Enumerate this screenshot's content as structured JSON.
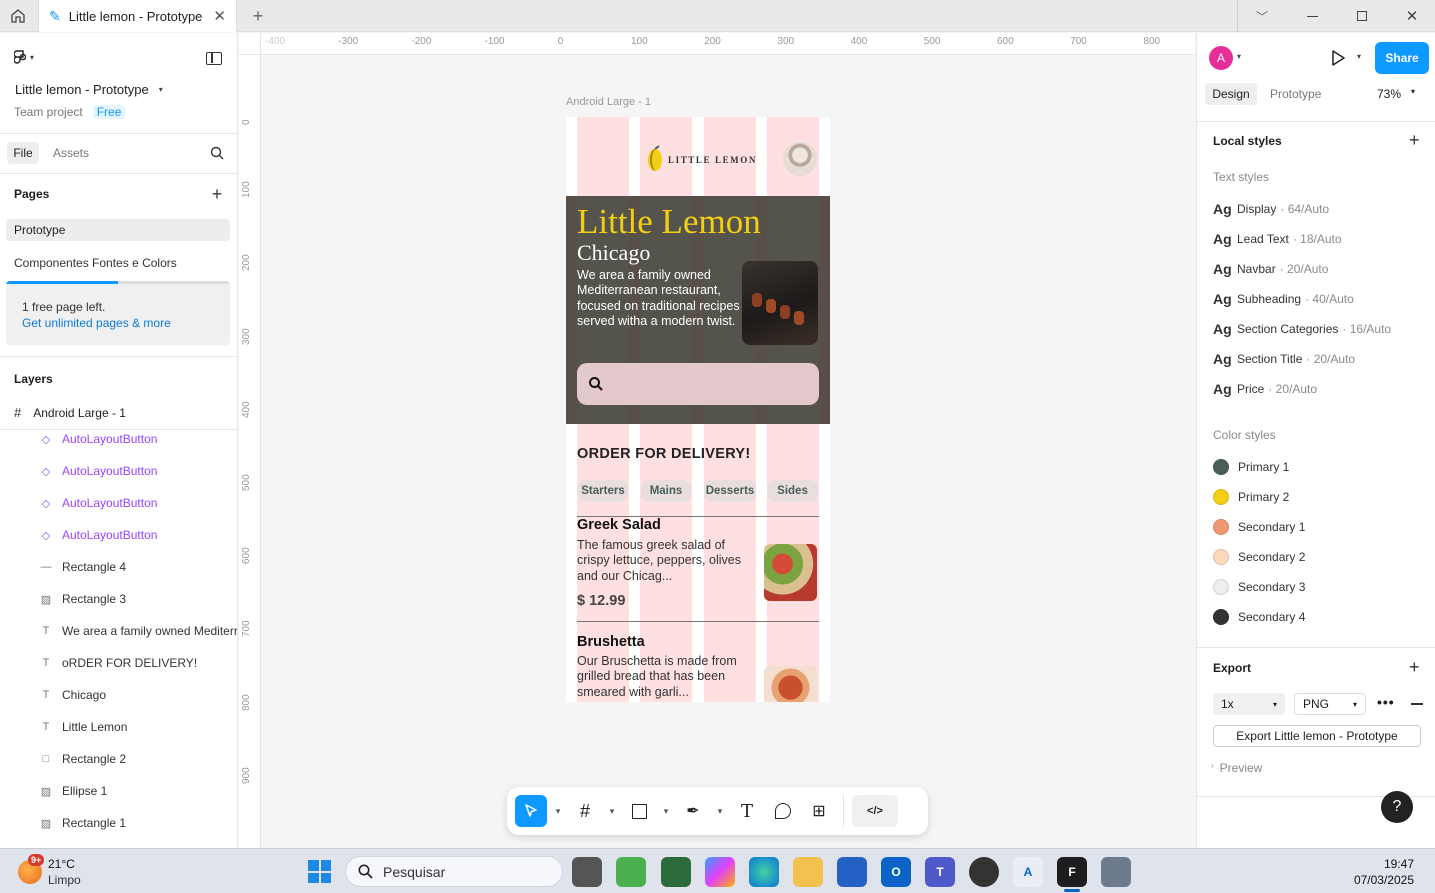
{
  "tab": {
    "title": "Little lemon - Prototype"
  },
  "file": {
    "name": "Little lemon - Prototype",
    "team": "Team project",
    "plan": "Free"
  },
  "left_tabs": {
    "file": "File",
    "assets": "Assets"
  },
  "pages": {
    "heading": "Pages",
    "items": [
      "Prototype",
      "Componentes Fontes e Colors"
    ]
  },
  "notice": {
    "text": "1 free page left.",
    "link": "Get unlimited pages & more",
    "progress": 0.5
  },
  "layers": {
    "heading": "Layers",
    "root": "Android Large - 1",
    "items": [
      {
        "name": "AutoLayoutButton",
        "icon": "component-icon"
      },
      {
        "name": "AutoLayoutButton",
        "icon": "component-icon"
      },
      {
        "name": "AutoLayoutButton",
        "icon": "component-icon"
      },
      {
        "name": "AutoLayoutButton",
        "icon": "component-icon"
      },
      {
        "name": "Rectangle 4",
        "icon": "line-icon"
      },
      {
        "name": "Rectangle 3",
        "icon": "image-icon"
      },
      {
        "name": "We area a family owned Mediterra",
        "icon": "text-icon"
      },
      {
        "name": "oRDER FOR DELIVERY!",
        "icon": "text-icon"
      },
      {
        "name": "Chicago",
        "icon": "text-icon"
      },
      {
        "name": "Little Lemon",
        "icon": "text-icon"
      },
      {
        "name": "Rectangle 2",
        "icon": "rectangle-icon"
      },
      {
        "name": "Ellipse 1",
        "icon": "image-icon"
      },
      {
        "name": "Rectangle 1",
        "icon": "image-icon"
      }
    ]
  },
  "ruler": {
    "h": [
      "-400",
      "-300",
      "-200",
      "-100",
      "0",
      "100",
      "200",
      "300",
      "400",
      "500",
      "600",
      "700",
      "800"
    ],
    "v": [
      "0",
      "100",
      "200",
      "300",
      "400",
      "500",
      "600",
      "700",
      "800",
      "900"
    ]
  },
  "frame": {
    "label": "Android Large - 1",
    "logo": "LITTLE LEMON",
    "hero_title": "Little Lemon",
    "hero_city": "Chicago",
    "hero_text": "We area a family owned Mediterranean restaurant, focused on traditional recipes served witha a modern twist.",
    "order_heading": "ORDER FOR DELIVERY!",
    "categories": [
      "Starters",
      "Mains",
      "Desserts",
      "Sides"
    ],
    "dishes": [
      {
        "name": "Greek Salad",
        "desc": "The famous greek salad of crispy lettuce, peppers, olives and our Chicag...",
        "price": "$ 12.99"
      },
      {
        "name": "Brushetta",
        "desc": "Our Bruschetta is made from grilled bread that has been smeared with garli...",
        "price": ""
      }
    ]
  },
  "right": {
    "avatar": "A",
    "share": "Share",
    "tabs": {
      "design": "Design",
      "prototype": "Prototype"
    },
    "zoom": "73%",
    "local_styles": "Local styles",
    "text_styles_heading": "Text styles",
    "text_styles": [
      {
        "name": "Display",
        "meta": "· 64/Auto"
      },
      {
        "name": "Lead Text",
        "meta": "· 18/Auto"
      },
      {
        "name": "Navbar",
        "meta": "· 20/Auto"
      },
      {
        "name": "Subheading",
        "meta": "· 40/Auto"
      },
      {
        "name": "Section Categories",
        "meta": "· 16/Auto"
      },
      {
        "name": "Section Title",
        "meta": "· 20/Auto"
      },
      {
        "name": "Price",
        "meta": "· 20/Auto"
      }
    ],
    "color_styles_heading": "Color styles",
    "color_styles": [
      {
        "name": "Primary 1",
        "color": "#495e57"
      },
      {
        "name": "Primary 2",
        "color": "#f4ce14"
      },
      {
        "name": "Secondary 1",
        "color": "#ee9972"
      },
      {
        "name": "Secondary 2",
        "color": "#fbdabb"
      },
      {
        "name": "Secondary 3",
        "color": "#edefee"
      },
      {
        "name": "Secondary 4",
        "color": "#333333"
      }
    ],
    "export": {
      "heading": "Export",
      "scale": "1x",
      "format": "PNG",
      "button": "Export Little lemon - Prototype",
      "preview": "Preview"
    }
  },
  "taskbar": {
    "weather_temp": "21°C",
    "weather_desc": "Limpo",
    "badge": "9+",
    "search": "Pesquisar",
    "time": "19:47",
    "date": "07/03/2025"
  },
  "colors": {
    "accent": "#0d99ff",
    "hero_bg": "#585048",
    "lemon_yellow": "#f4ce14"
  }
}
